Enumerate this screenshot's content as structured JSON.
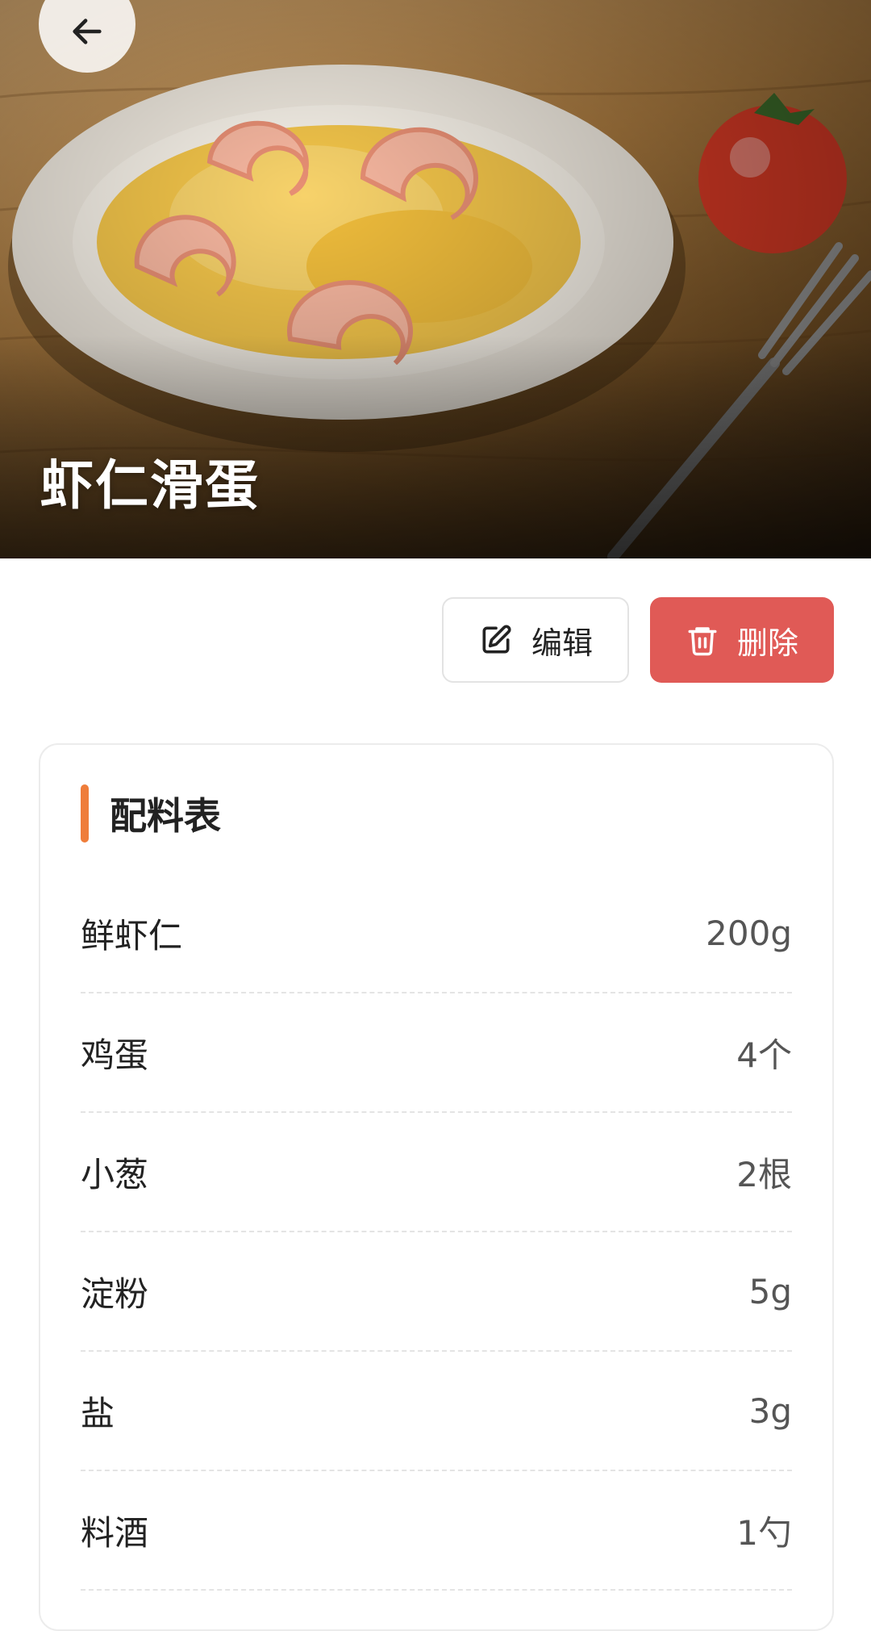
{
  "recipe": {
    "title": "虾仁滑蛋"
  },
  "actions": {
    "edit_label": "编辑",
    "delete_label": "删除"
  },
  "ingredients": {
    "title": "配料表",
    "items": [
      {
        "name": "鲜虾仁",
        "amount": "200g"
      },
      {
        "name": "鸡蛋",
        "amount": "4个"
      },
      {
        "name": "小葱",
        "amount": "2根"
      },
      {
        "name": "淀粉",
        "amount": "5g"
      },
      {
        "name": "盐",
        "amount": "3g"
      },
      {
        "name": "料酒",
        "amount": "1勺"
      }
    ]
  },
  "colors": {
    "accent": "#ef7d3a",
    "delete": "#e05a56"
  }
}
